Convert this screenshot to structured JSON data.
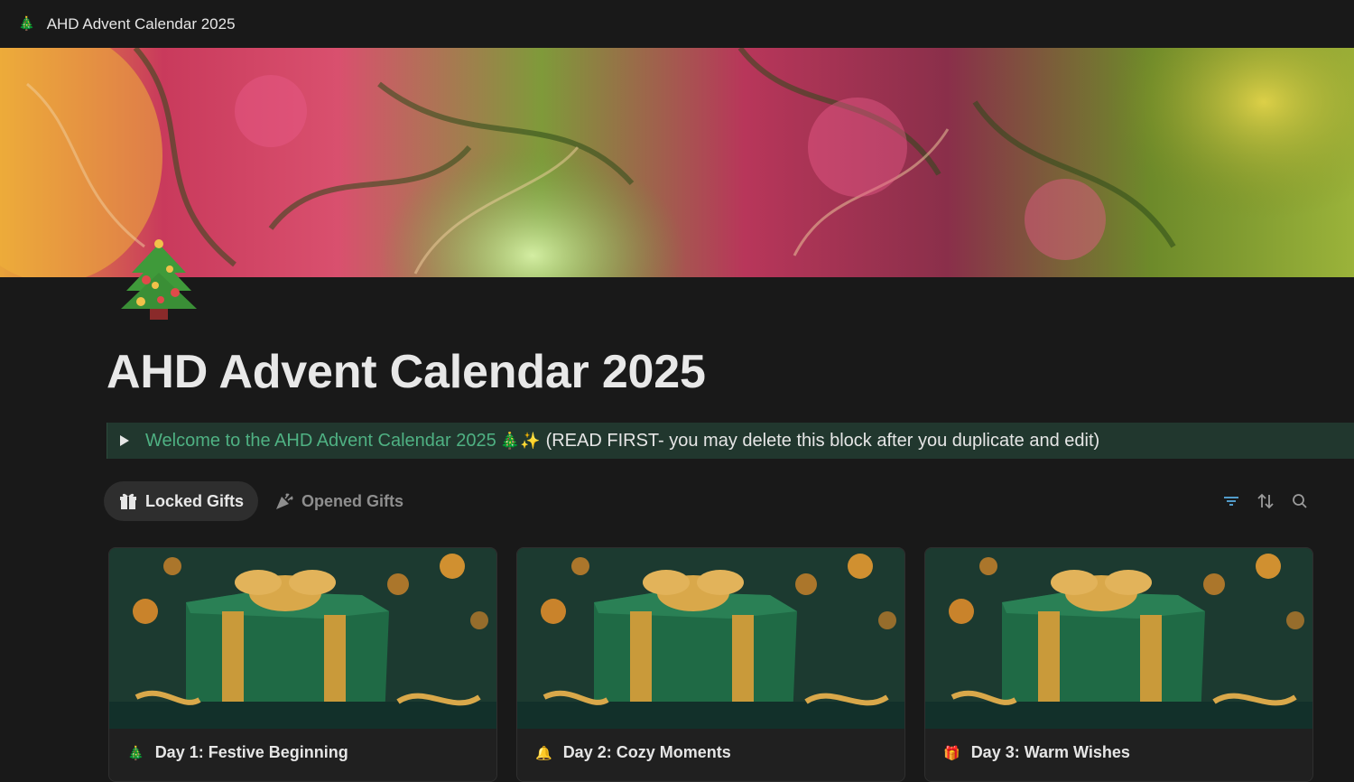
{
  "window": {
    "icon": "christmas-tree-icon",
    "icon_glyph": "🎄",
    "title": "AHD Advent Calendar 2025"
  },
  "page": {
    "icon": "christmas-tree-icon",
    "title": "AHD Advent Calendar 2025"
  },
  "toggle_block": {
    "highlighted_text": "Welcome to the AHD Advent Calendar 2025",
    "emojis": "🎄✨",
    "plain_text": "(READ FIRST- you may delete this block after you duplicate and edit)",
    "highlight_color": "#4fb183",
    "background_color": "#21372e"
  },
  "views": {
    "tabs": [
      {
        "label": "Locked Gifts",
        "icon": "gift-icon",
        "active": true
      },
      {
        "label": "Opened Gifts",
        "icon": "party-popper-icon",
        "active": false
      }
    ],
    "tools": [
      {
        "icon": "filter-icon",
        "color": "#529cca"
      },
      {
        "icon": "sort-icon",
        "color": "#9b9b9b"
      },
      {
        "icon": "search-icon",
        "color": "#9b9b9b"
      }
    ]
  },
  "cards": [
    {
      "icon": "christmas-tree-icon",
      "icon_glyph": "🎄",
      "title": "Day 1: Festive Beginning"
    },
    {
      "icon": "bell-icon",
      "icon_glyph": "🔔",
      "title": "Day 2: Cozy Moments"
    },
    {
      "icon": "gift-icon",
      "icon_glyph": "🎁",
      "title": "Day 3: Warm Wishes"
    }
  ],
  "colors": {
    "background": "#191919",
    "text": "#e6e6e6",
    "accent_blue": "#529cca"
  }
}
